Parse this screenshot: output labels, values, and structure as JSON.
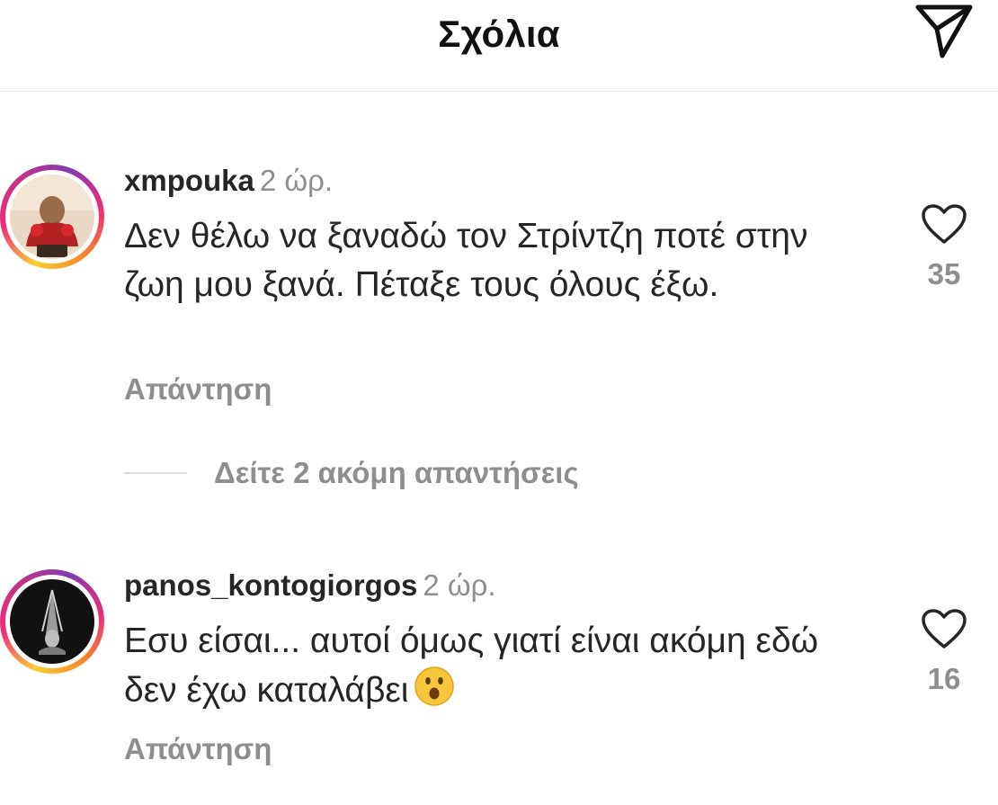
{
  "header": {
    "title": "Σχόλια",
    "send_icon": "send-icon"
  },
  "comments": [
    {
      "username": "xmpouka",
      "time": "2 ώρ.",
      "text": "Δεν θέλω να ξαναδώ τον Στρίντζη ποτέ στην ζωη μου ξανά. Πέταξε τους όλους έξω.",
      "likes": "35",
      "reply_label": "Απάντηση",
      "view_replies": "Δείτε 2 ακόμη απαντήσεις"
    },
    {
      "username": "panos_kontogiorgos",
      "time": "2 ώρ.",
      "text": "Εσυ είσαι... αυτοί όμως γιατί είναι ακόμη εδώ δεν έχω καταλάβει",
      "emoji": "😮",
      "likes": "16",
      "reply_label": "Απάντηση"
    }
  ],
  "colors": {
    "text": "#262626",
    "secondary": "#8e8e8e",
    "divider": "#ececec"
  }
}
